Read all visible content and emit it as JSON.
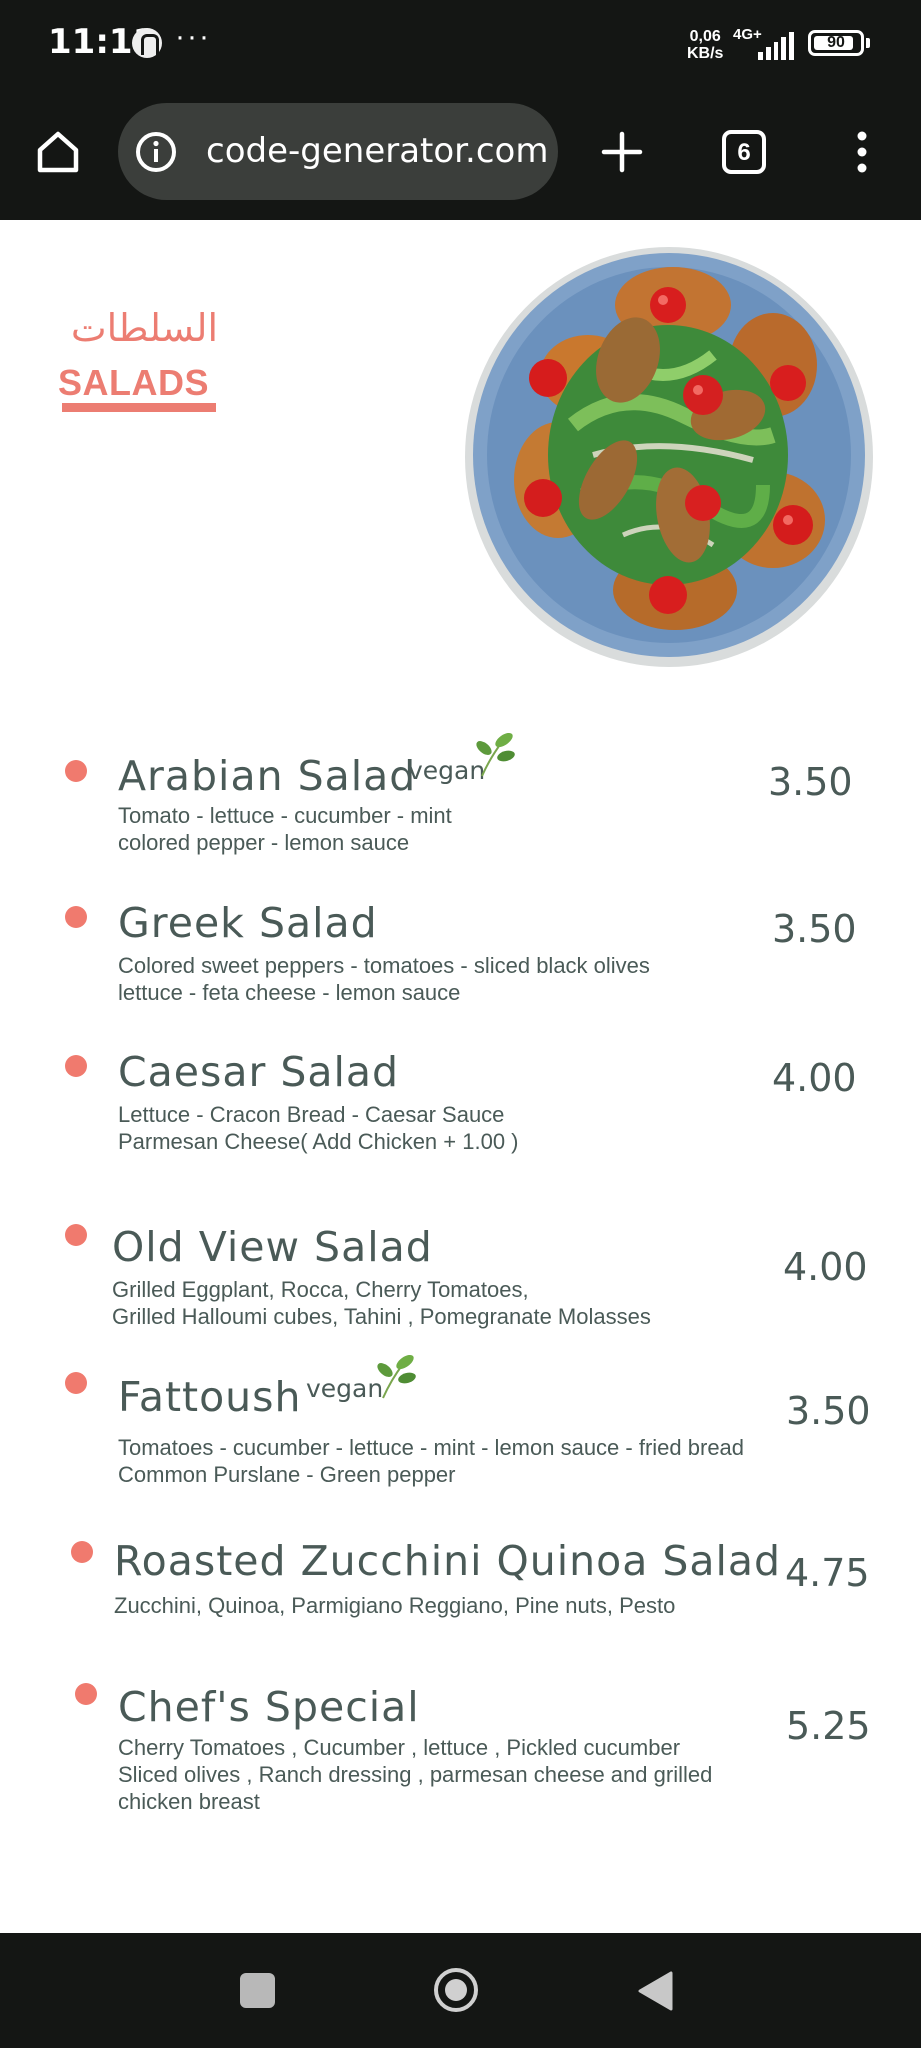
{
  "status_bar": {
    "time": "11:11",
    "more": "···",
    "speed_value": "0,06",
    "speed_unit": "KB/s",
    "network": "4G+",
    "battery": "90",
    "battery_level_percent": 90
  },
  "browser": {
    "url": "code-generator.com",
    "tab_count": "6"
  },
  "header": {
    "arabic_title": "السلطات",
    "title": "SALADS"
  },
  "menu": [
    {
      "name": "Arabian Salad",
      "tag": "vegan",
      "desc1": "Tomato - lettuce - cucumber - mint",
      "desc2": "colored pepper - lemon sauce",
      "desc3": "",
      "price": "3.50"
    },
    {
      "name": "Greek Salad",
      "tag": "",
      "desc1": "Colored sweet peppers - tomatoes - sliced black olives",
      "desc2": "lettuce - feta cheese - lemon sauce",
      "desc3": "",
      "price": "3.50"
    },
    {
      "name": "Caesar Salad",
      "tag": "",
      "desc1": "Lettuce - Cracon Bread - Caesar Sauce",
      "desc2": "Parmesan Cheese( Add Chicken + 1.00 )",
      "desc3": "",
      "price": "4.00"
    },
    {
      "name": "Old View Salad",
      "tag": "",
      "desc1": "Grilled Eggplant, Rocca, Cherry Tomatoes,",
      "desc2": "Grilled Halloumi cubes, Tahini , Pomegranate Molasses",
      "desc3": "",
      "price": "4.00"
    },
    {
      "name": "Fattoush",
      "tag": "vegan",
      "desc1": "Tomatoes - cucumber - lettuce - mint - lemon sauce - fried bread",
      "desc2": "Common Purslane - Green pepper",
      "desc3": "",
      "price": "3.50"
    },
    {
      "name": "Roasted Zucchini Quinoa Salad",
      "tag": "",
      "desc1": "Zucchini, Quinoa, Parmigiano Reggiano, Pine nuts, Pesto",
      "desc2": "",
      "desc3": "",
      "price": "4.75"
    },
    {
      "name": "Chef's Special",
      "tag": "",
      "desc1": "Cherry Tomatoes , Cucumber , lettuce , Pickled cucumber",
      "desc2": "Sliced olives , Ranch dressing , parmesan cheese and grilled",
      "desc3": "chicken breast",
      "price": "5.25"
    }
  ],
  "colors": {
    "accent": "#ec7d72",
    "text": "#4a5a57",
    "bar_background": "#141614"
  }
}
